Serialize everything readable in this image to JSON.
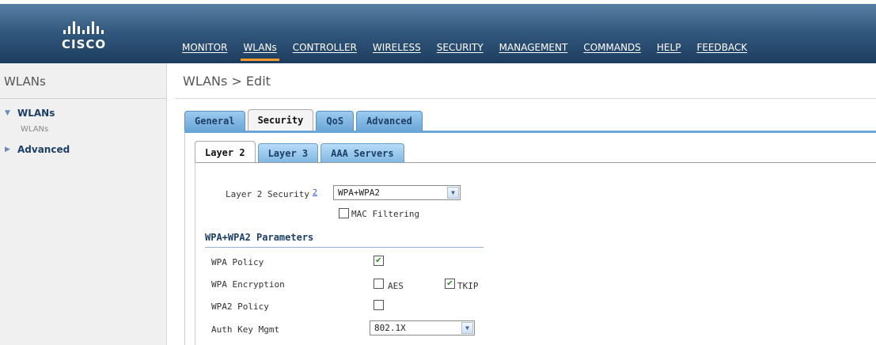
{
  "brand": {
    "logo_text": "CISCO"
  },
  "nav": [
    {
      "label": "MONITOR",
      "active": false
    },
    {
      "label": "WLANs",
      "active": true
    },
    {
      "label": "CONTROLLER",
      "active": false
    },
    {
      "label": "WIRELESS",
      "active": false
    },
    {
      "label": "SECURITY",
      "active": false
    },
    {
      "label": "MANAGEMENT",
      "active": false
    },
    {
      "label": "COMMANDS",
      "active": false
    },
    {
      "label": "HELP",
      "active": false
    },
    {
      "label": "FEEDBACK",
      "active": false
    }
  ],
  "sidebar": {
    "title": "WLANs",
    "items": [
      {
        "label": "WLANs",
        "expanded": true,
        "sub": "WLANs"
      },
      {
        "label": "Advanced",
        "expanded": false
      }
    ]
  },
  "page": {
    "title": "WLANs > Edit"
  },
  "tabs": [
    {
      "label": "General",
      "active": false
    },
    {
      "label": "Security",
      "active": true
    },
    {
      "label": "QoS",
      "active": false
    },
    {
      "label": "Advanced",
      "active": false
    }
  ],
  "subtabs": [
    {
      "label": "Layer 2",
      "active": true
    },
    {
      "label": "Layer 3",
      "active": false
    },
    {
      "label": "AAA Servers",
      "active": false
    }
  ],
  "layer2": {
    "security_label": "Layer 2 Security",
    "help_marker": "2",
    "security_value": "WPA+WPA2",
    "mac_filtering_label": "MAC Filtering",
    "mac_filtering_checked": false
  },
  "wpa": {
    "section_title": "WPA+WPA2 Parameters",
    "wpa_policy_label": "WPA Policy",
    "wpa_policy_checked": true,
    "wpa_encryption_label": "WPA Encryption",
    "aes_label": "AES",
    "aes_checked": false,
    "tkip_label": "TKIP",
    "tkip_checked": true,
    "wpa2_policy_label": "WPA2 Policy",
    "wpa2_policy_checked": false,
    "auth_key_label": "Auth Key Mgmt",
    "auth_key_value": "802.1X"
  },
  "colors": {
    "header": "#33597f",
    "active_nav_underline": "#f39a2c",
    "tab": "#6aa6d8",
    "section_title": "#1d3f66"
  },
  "icons": {
    "expanded": "triangle-down-icon",
    "collapsed": "triangle-right-icon",
    "dropdown": "chevron-down-icon",
    "check": "checkmark-icon"
  }
}
